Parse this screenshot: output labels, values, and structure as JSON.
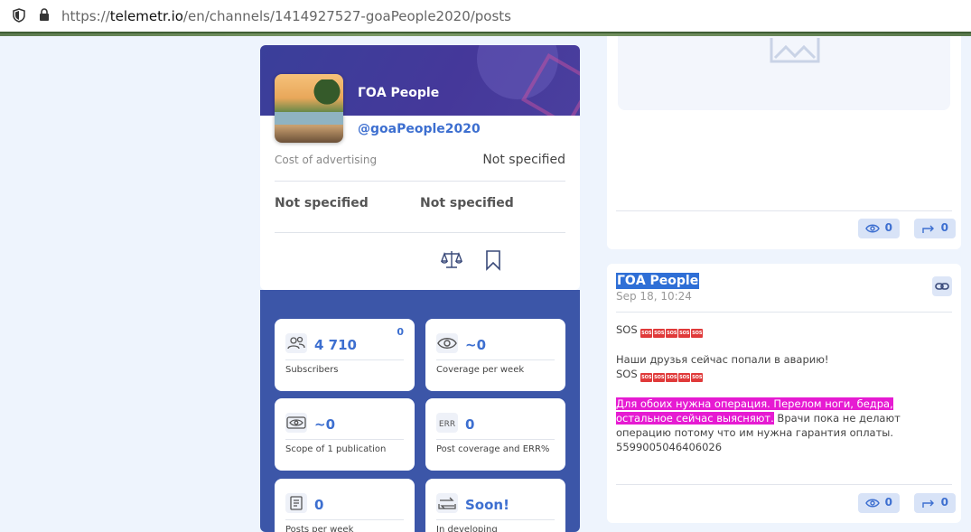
{
  "browser": {
    "url_domain": "telemetr.io",
    "url_prefix": "https://",
    "url_path": "/en/channels/1414927527-goaPeople2020/posts"
  },
  "channel": {
    "title": "ГОА People",
    "handle": "@goaPeople2020",
    "cost_label": "Cost of advertising",
    "cost_value": "Not specified",
    "left_value": "Not specified",
    "right_value": "Not specified"
  },
  "stats": [
    {
      "value": "4 710",
      "label": "Subscribers",
      "badge": "0",
      "icon": "users-icon"
    },
    {
      "value": "~0",
      "label": "Coverage per week",
      "icon": "eye-icon"
    },
    {
      "value": "~0",
      "label": "Scope of 1 publication",
      "icon": "eye-tag-icon"
    },
    {
      "value": "0",
      "label": "Post coverage and ERR%",
      "icon": "err-icon"
    },
    {
      "value": "0",
      "label": "Posts per week",
      "icon": "document-icon"
    },
    {
      "value": "Soon!",
      "label": "In developing",
      "icon": "repost-box-icon"
    }
  ],
  "posts": [
    {
      "views": "0",
      "shares": "0"
    },
    {
      "author": "ГОА People",
      "date": "Sep 18, 10:24",
      "line1": "SOS",
      "line2": "Наши друзья сейчас попали в аварию!",
      "line3": "SOS",
      "highlight": "Для обоих нужна операция. Перелом ноги, бедра, остальное сейчас выясняют.",
      "rest": " Врачи пока не делают операцию потому что им нужна гарантия оплаты.",
      "number": "5599005046406026",
      "sos_label": "SOS",
      "views": "0",
      "shares": "0"
    }
  ]
}
